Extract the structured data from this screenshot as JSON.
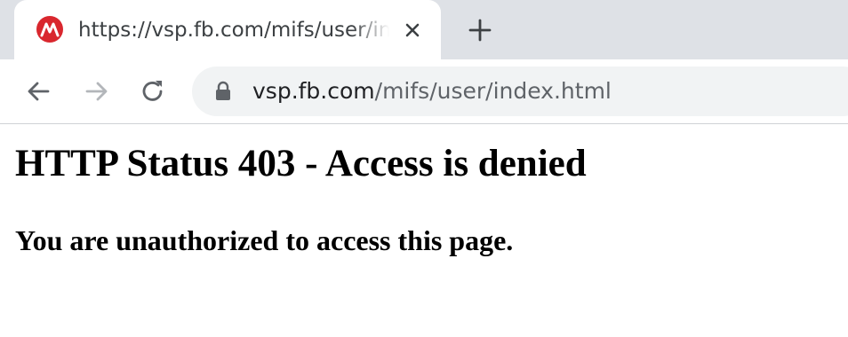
{
  "tab": {
    "title": "https://vsp.fb.com/mifs/user/index.html",
    "favicon": "mobileiron-logo-icon",
    "favicon_color": "#d9272e"
  },
  "toolbar": {
    "back_icon": "arrow-left-icon",
    "forward_icon": "arrow-right-icon",
    "reload_icon": "reload-icon",
    "new_tab_icon": "plus-icon",
    "close_icon": "close-icon"
  },
  "address_bar": {
    "host": "vsp.fb.com",
    "path": "/mifs/user/index.html",
    "lock_icon": "lock-icon"
  },
  "content": {
    "heading": "HTTP Status 403 - Access is denied",
    "message": "You are unauthorized to access this page."
  },
  "colors": {
    "tabstrip_bg": "#dee1e6",
    "omnibox_bg": "#f1f3f4",
    "icon_color": "#5f6368",
    "disabled_icon": "#b3b6ba"
  }
}
